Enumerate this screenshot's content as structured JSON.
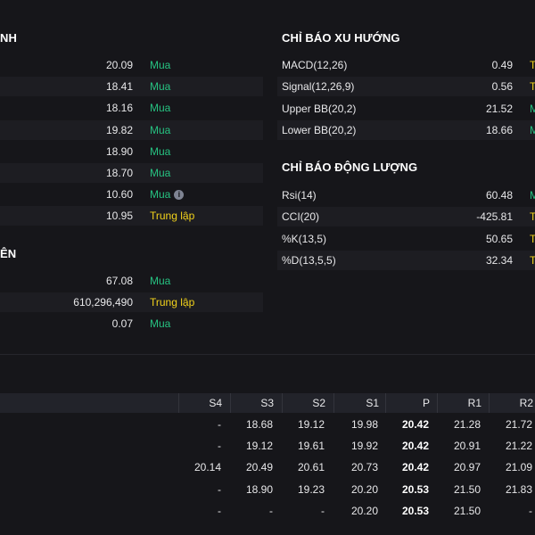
{
  "left": {
    "section1_title": "NH",
    "ma_rows": [
      {
        "value": "20.09",
        "signal": "Mua",
        "type": "buy"
      },
      {
        "value": "18.41",
        "signal": "Mua",
        "type": "buy"
      },
      {
        "value": "18.16",
        "signal": "Mua",
        "type": "buy"
      },
      {
        "value": "19.82",
        "signal": "Mua",
        "type": "buy"
      },
      {
        "value": "18.90",
        "signal": "Mua",
        "type": "buy"
      },
      {
        "value": "18.70",
        "signal": "Mua",
        "type": "buy"
      },
      {
        "value": "10.60",
        "signal": "Mua",
        "type": "buy",
        "info": "i"
      },
      {
        "value": "10.95",
        "signal": "Trung lập",
        "type": "neutral"
      }
    ],
    "section2_title": "ÊN",
    "vol_rows": [
      {
        "value": "67.08",
        "signal": "Mua",
        "type": "buy"
      },
      {
        "value": "610,296,490",
        "signal": "Trung lập",
        "type": "neutral"
      },
      {
        "value": "0.07",
        "signal": "Mua",
        "type": "buy"
      }
    ]
  },
  "right": {
    "trend_title": "CHỈ BÁO XU HƯỚNG",
    "trend_rows": [
      {
        "label": "MACD(12,26)",
        "value": "0.49",
        "signal": "T",
        "type": "neutral"
      },
      {
        "label": "Signal(12,26,9)",
        "value": "0.56",
        "signal": "T",
        "type": "neutral"
      },
      {
        "label": "Upper BB(20,2)",
        "value": "21.52",
        "signal": "M",
        "type": "buy"
      },
      {
        "label": "Lower BB(20,2)",
        "value": "18.66",
        "signal": "M",
        "type": "buy"
      }
    ],
    "momentum_title": "CHỈ BÁO ĐỘNG LƯỢNG",
    "momentum_rows": [
      {
        "label": "Rsi(14)",
        "value": "60.48",
        "signal": "M",
        "type": "buy"
      },
      {
        "label": "CCI(20)",
        "value": "-425.81",
        "signal": "T",
        "type": "neutral"
      },
      {
        "label": "%K(13,5)",
        "value": "50.65",
        "signal": "T",
        "type": "neutral"
      },
      {
        "label": "%D(13,5,5)",
        "value": "32.34",
        "signal": "T",
        "type": "neutral"
      }
    ]
  },
  "pivot_table": {
    "headers": [
      "S4",
      "S3",
      "S2",
      "S1",
      "P",
      "R1",
      "R2"
    ],
    "rows": [
      [
        "-",
        "18.68",
        "19.12",
        "19.98",
        "20.42",
        "21.28",
        "21.72"
      ],
      [
        "-",
        "19.12",
        "19.61",
        "19.92",
        "20.42",
        "20.91",
        "21.22"
      ],
      [
        "20.14",
        "20.49",
        "20.61",
        "20.73",
        "20.42",
        "20.97",
        "21.09"
      ],
      [
        "-",
        "18.90",
        "19.23",
        "20.20",
        "20.53",
        "21.50",
        "21.83"
      ],
      [
        "-",
        "-",
        "-",
        "20.20",
        "20.53",
        "21.50",
        "-"
      ]
    ]
  },
  "colors": {
    "background": "#16161a",
    "buy": "#26c281",
    "neutral": "#f2d21b"
  }
}
